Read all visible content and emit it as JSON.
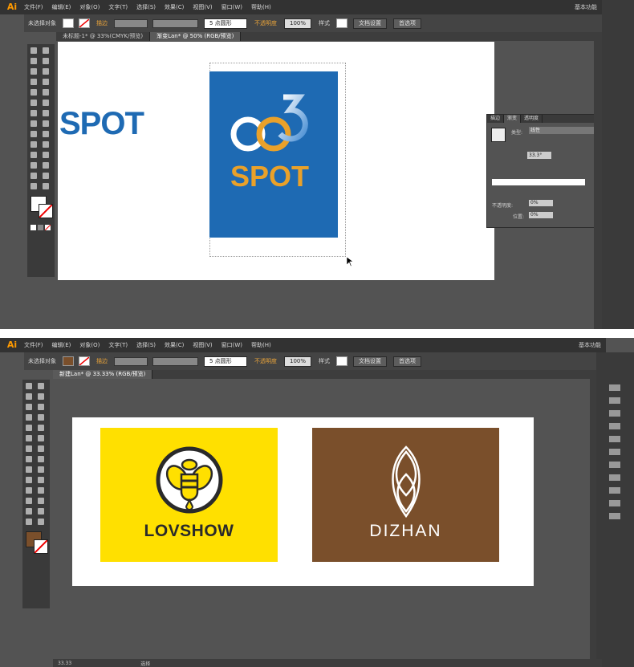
{
  "top": {
    "menu": [
      "文件(F)",
      "编辑(E)",
      "对象(O)",
      "文字(T)",
      "选择(S)",
      "效果(C)",
      "视图(V)",
      "窗口(W)",
      "帮助(H)"
    ],
    "workspace": "基本功能",
    "ctrl": {
      "no_selection": "未选择对象",
      "stroke": "描边",
      "brush": "5 点圆形",
      "opacity": "不透明度",
      "opacity_val": "100%",
      "style": "样式",
      "doc_setup": "文档设置",
      "prefs": "首选项"
    },
    "tabs": [
      "未标题-1* @ 33%(CMYK/预览)",
      "渐变Lan* @ 50% (RGB/预览)"
    ],
    "spot_text": "SPOT",
    "logo_main": "SPOT",
    "gradient_panel": {
      "tabs": [
        "描边",
        "渐变",
        "透明度"
      ],
      "type_label": "类型:",
      "type_val": "线性",
      "angle_val": "33.3°",
      "opacity_label": "不透明度:",
      "opacity_val": "0%",
      "pos_label": "位置:",
      "pos_val": "0%"
    }
  },
  "bottom": {
    "menu": [
      "文件(F)",
      "编辑(E)",
      "对象(O)",
      "文字(T)",
      "选择(S)",
      "效果(C)",
      "视图(V)",
      "窗口(W)",
      "帮助(H)"
    ],
    "workspace": "基本功能",
    "ctrl": {
      "no_selection": "未选择对象",
      "stroke": "描边",
      "brush": "5 点圆形",
      "opacity": "不透明度",
      "opacity_val": "100%",
      "style": "样式",
      "doc_setup": "文档设置",
      "prefs": "首选项"
    },
    "tabs": [
      "新建Lan* @ 33.33% (RGB/预览)"
    ],
    "card1_text": "LOVSHOW",
    "card2_text": "DIZHAN",
    "status_zoom": "33.33",
    "status_label": "选择"
  },
  "colors": {
    "blue": "#1e6ab3",
    "orange": "#e9a12a",
    "yellow": "#ffe000",
    "brown": "#7a4f2b",
    "dark": "#2a2a2a"
  }
}
